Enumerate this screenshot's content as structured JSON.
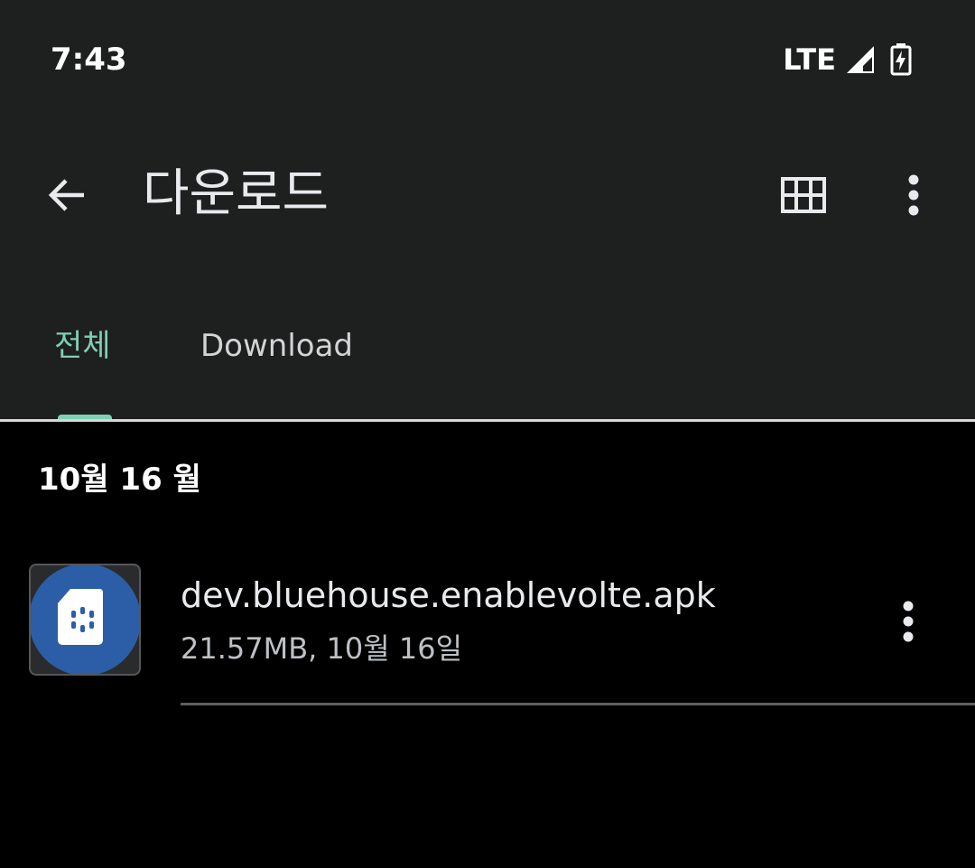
{
  "status_bar": {
    "time": "7:43",
    "network": "LTE",
    "signal_icon": "cell-signal-icon",
    "battery_icon": "battery-charging-icon"
  },
  "app_bar": {
    "title": "다운로드",
    "back_icon": "arrow-back-icon",
    "grid_icon": "grid-view-icon",
    "more_icon": "more-vert-icon"
  },
  "tabs": [
    {
      "label": "전체",
      "selected": true
    },
    {
      "label": "Download",
      "selected": false
    }
  ],
  "sections": [
    {
      "header": "10월 16 월",
      "files": [
        {
          "name": "dev.bluehouse.enablevolte.apk",
          "meta": "21.57MB, 10월 16일",
          "thumbnail_icon": "sim-card-icon",
          "more_icon": "more-vert-icon"
        }
      ]
    }
  ],
  "colors": {
    "header_bg": "#1e1f1f",
    "content_bg": "#000000",
    "accent": "#7fcfb4",
    "thumbnail_blue": "#2b5ea6"
  }
}
